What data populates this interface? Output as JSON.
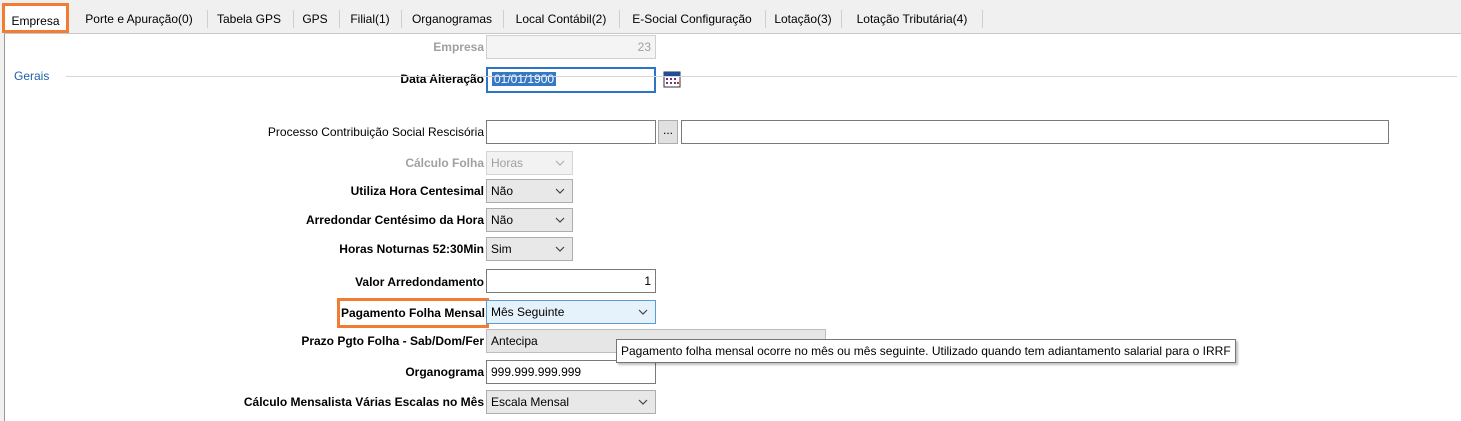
{
  "tabs": [
    {
      "label": "Empresa",
      "active": true
    },
    {
      "label": "Porte e Apuração(0)"
    },
    {
      "label": "Tabela GPS"
    },
    {
      "label": "GPS"
    },
    {
      "label": "Filial(1)"
    },
    {
      "label": "Organogramas"
    },
    {
      "label": "Local Contábil(2)"
    },
    {
      "label": "E-Social Configuração"
    },
    {
      "label": "Lotação(3)"
    },
    {
      "label": "Lotação Tributária(4)"
    }
  ],
  "header": {
    "empresa_label": "Empresa",
    "empresa_value": "23",
    "data_alteracao_label": "Data Alteração",
    "data_alteracao_value": "01/01/1900"
  },
  "section": {
    "label": "Gerais"
  },
  "fields": {
    "processo_label": "Processo Contribuição Social Rescisória",
    "processo_value": "",
    "processo_button": "...",
    "processo_desc": "",
    "calculo_folha_label": "Cálculo Folha",
    "calculo_folha_value": "Horas",
    "utiliza_hora_label": "Utiliza Hora Centesimal",
    "utiliza_hora_value": "Não",
    "arredondar_label": "Arredondar Centésimo da Hora",
    "arredondar_value": "Não",
    "horas_noturnas_label": "Horas Noturnas 52:30Min",
    "horas_noturnas_value": "Sim",
    "valor_arred_label": "Valor Arredondamento",
    "valor_arred_value": "1",
    "pagamento_label": "Pagamento Folha Mensal",
    "pagamento_value": "Mês Seguinte",
    "prazo_label": "Prazo Pgto Folha - Sab/Dom/Fer",
    "prazo_value": "Antecipa",
    "organograma_label": "Organograma",
    "organograma_value": "999.999.999.999",
    "calc_mensalista_label": "Cálculo Mensalista Várias Escalas no Mês",
    "calc_mensalista_value": "Escala Mensal"
  },
  "tooltip": {
    "text": "Pagamento folha mensal ocorre no mês ou mês seguinte. Utilizado quando tem adiantamento salarial para o IRRF"
  },
  "colors": {
    "highlight": "#f07d32",
    "section": "#1f5fa8",
    "focus": "#2d74c9"
  }
}
